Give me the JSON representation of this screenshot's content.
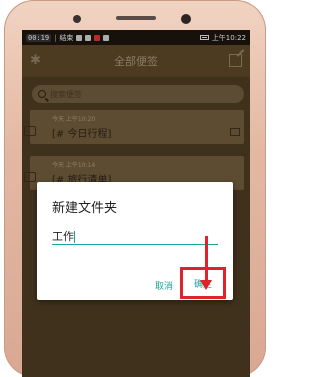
{
  "status_bar": {
    "time": "00:19",
    "carrier": "结束",
    "right_text": "上午10:22"
  },
  "app": {
    "title": "全部便签",
    "search_placeholder": "搜索便签"
  },
  "notes": [
    {
      "timestamp": "今天 上午10:20",
      "title": "[# 今日行程]"
    },
    {
      "timestamp": "今天 上午10:14",
      "title": "[# 旅行清单]"
    }
  ],
  "dialog": {
    "title": "新建文件夹",
    "input_value": "工作",
    "cancel_label": "取消",
    "ok_label": "确定"
  },
  "colors": {
    "accent": "#1aa69a",
    "highlight": "#e0222a"
  }
}
